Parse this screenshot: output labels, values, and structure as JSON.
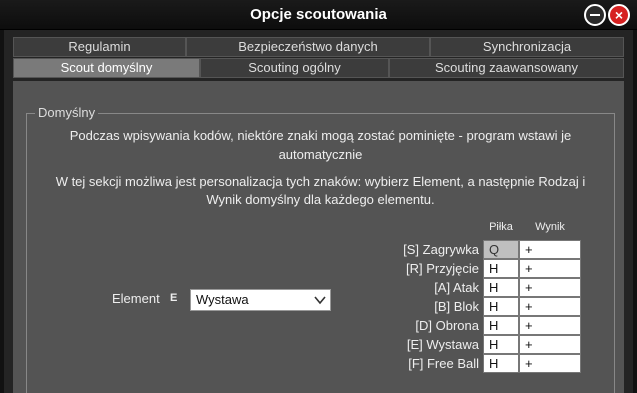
{
  "window": {
    "title": "Opcje scoutowania"
  },
  "tabs_row1": [
    "Regulamin",
    "Bezpieczeństwo danych",
    "Synchronizacja"
  ],
  "tabs_row2": [
    "Scout domyślny",
    "Scouting ogólny",
    "Scouting zaawansowany"
  ],
  "group": {
    "legend": "Domyślny",
    "desc1a": "Podczas wpisywania kodów, niektóre znaki mogą zostać pominięte - program wstawi je",
    "desc1b": "automatycznie",
    "desc2a": "W tej sekcji możliwa jest personalizacja tych znaków: wybierz Element, a następnie Rodzaj i",
    "desc2b": "Wynik domyślny dla każdego elementu."
  },
  "element": {
    "label": "Element",
    "code": "E",
    "selected": "Wystawa"
  },
  "table": {
    "headers": [
      "Piłka",
      "Wynik"
    ],
    "rows": [
      {
        "label": "[S] Zagrywka",
        "pilka": "Q",
        "wynik": "+"
      },
      {
        "label": "[R] Przyjęcie",
        "pilka": "H",
        "wynik": "+"
      },
      {
        "label": "[A] Atak",
        "pilka": "H",
        "wynik": "+"
      },
      {
        "label": "[B] Blok",
        "pilka": "H",
        "wynik": "+"
      },
      {
        "label": "[D] Obrona",
        "pilka": "H",
        "wynik": "+"
      },
      {
        "label": "[E] Wystawa",
        "pilka": "H",
        "wynik": "+"
      },
      {
        "label": "[F] Free Ball",
        "pilka": "H",
        "wynik": "+"
      }
    ]
  },
  "active_tab_color": "#7a7a7a",
  "close_button_color": "#d62020"
}
